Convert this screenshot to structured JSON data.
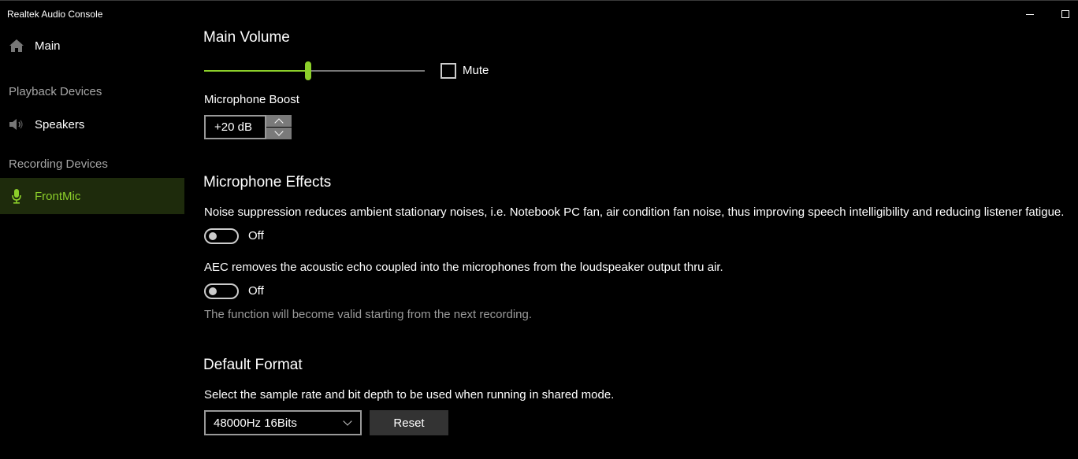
{
  "window": {
    "title": "Realtek Audio Console",
    "controls": {
      "minimize": "minimize-icon",
      "maximize": "maximize-icon"
    }
  },
  "sidebar": {
    "main": {
      "label": "Main",
      "icon": "home-icon"
    },
    "playback_header": "Playback Devices",
    "playback_items": [
      {
        "label": "Speakers",
        "icon": "speaker-icon"
      }
    ],
    "recording_header": "Recording Devices",
    "recording_items": [
      {
        "label": "FrontMic",
        "icon": "microphone-icon",
        "active": true
      }
    ]
  },
  "colors": {
    "accent": "#8ccf2a",
    "active_bg": "#1e2b0c"
  },
  "main_volume": {
    "title": "Main Volume",
    "value_fraction": 0.47,
    "mute_label": "Mute",
    "muted": false
  },
  "mic_boost": {
    "label": "Microphone Boost",
    "value": "+20 dB"
  },
  "effects": {
    "title": "Microphone Effects",
    "noise_suppression": {
      "description": "Noise suppression reduces ambient stationary noises, i.e. Notebook PC fan, air condition fan noise, thus improving speech intelligibility and reducing listener fatigue.",
      "state_label": "Off",
      "on": false
    },
    "aec": {
      "description": "AEC removes the acoustic echo coupled into the microphones from the loudspeaker output thru air.",
      "state_label": "Off",
      "on": false
    },
    "note": "The function will become valid starting from the next recording."
  },
  "default_format": {
    "title": "Default Format",
    "description": "Select the sample rate and bit depth to be used when running in shared mode.",
    "selected": "48000Hz 16Bits",
    "reset_label": "Reset"
  }
}
